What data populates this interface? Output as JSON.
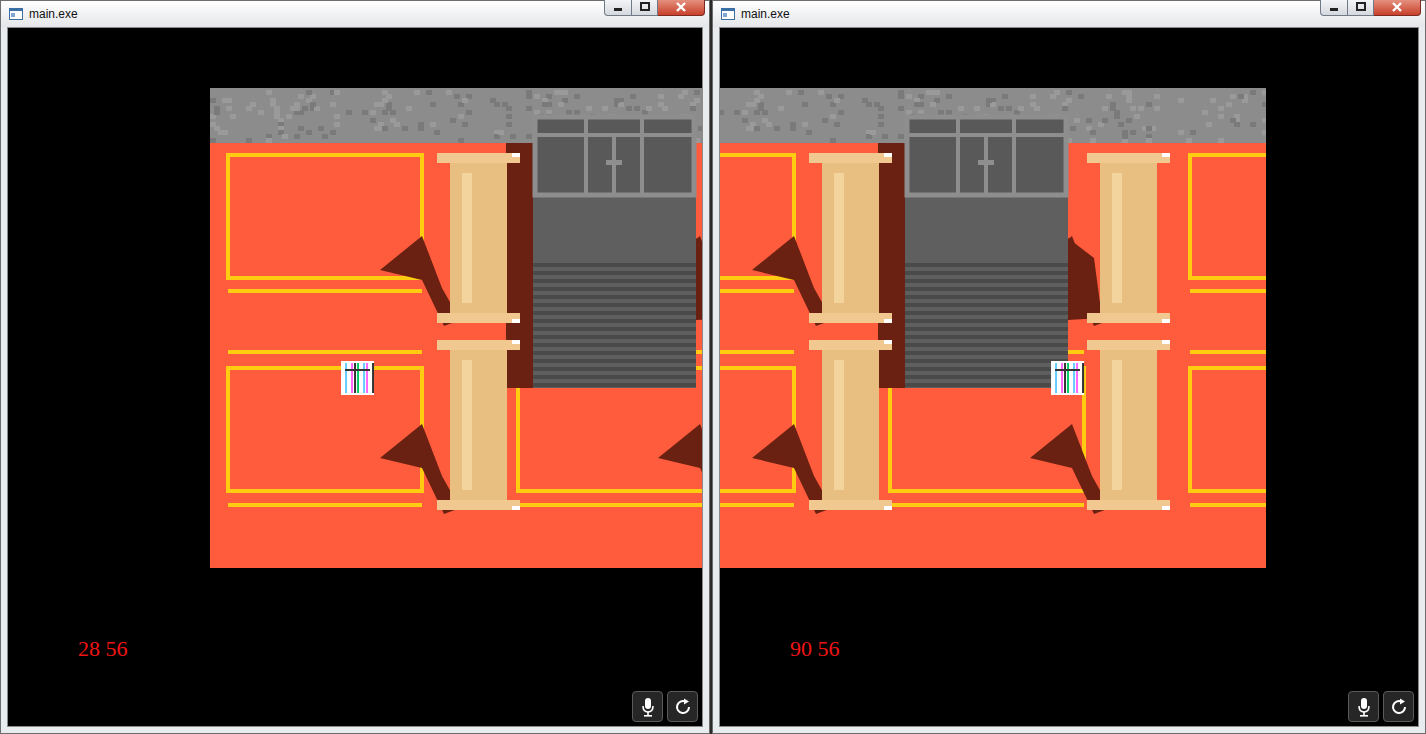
{
  "windows": [
    {
      "title": "main.exe",
      "coords": "28 56"
    },
    {
      "title": "main.exe",
      "coords": "90 56"
    }
  ]
}
